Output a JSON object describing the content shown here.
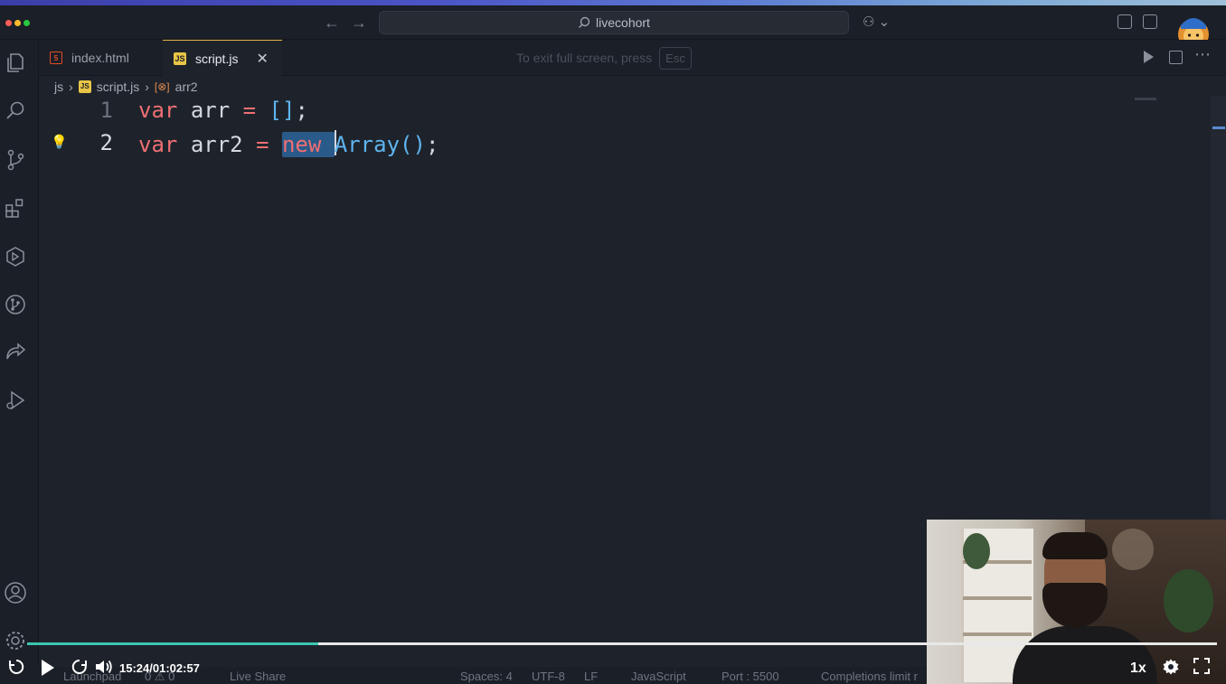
{
  "titlebar": {
    "search_text": "livecohort"
  },
  "tabs": [
    {
      "label": "index.html",
      "icon": "html5-file-icon"
    },
    {
      "label": "script.js",
      "icon": "js-file-icon",
      "active": true
    }
  ],
  "fullscreen_hint": {
    "text": "To exit full screen, press",
    "key": "Esc"
  },
  "breadcrumb": {
    "folder": "js",
    "file": "script.js",
    "symbol": "arr2"
  },
  "editor": {
    "lines": [
      {
        "number": "1",
        "tokens": {
          "kw": "var",
          "id": "arr",
          "op": "=",
          "br": "[]",
          "end": ";"
        }
      },
      {
        "number": "2",
        "tokens": {
          "kw": "var",
          "id": "arr2",
          "op": "=",
          "sel": "new",
          "cls": "Array",
          "paren": "()",
          "end": ";"
        }
      }
    ]
  },
  "statusbar": {
    "launchpad": "Launchpad",
    "errors": "0 ⚠ 0",
    "live_share": "Live Share",
    "spaces": "Spaces: 4",
    "encoding": "UTF-8",
    "eol": "LF",
    "language": "JavaScript",
    "port": "Port : 5500",
    "completions": "Completions limit r"
  },
  "video": {
    "time": "15:24/01:02:57",
    "speed": "1x",
    "progress": 0.245
  },
  "colors": {
    "keyword": "#ef6f72",
    "class": "#5fb4f0",
    "progress": "#3bc6b0"
  }
}
